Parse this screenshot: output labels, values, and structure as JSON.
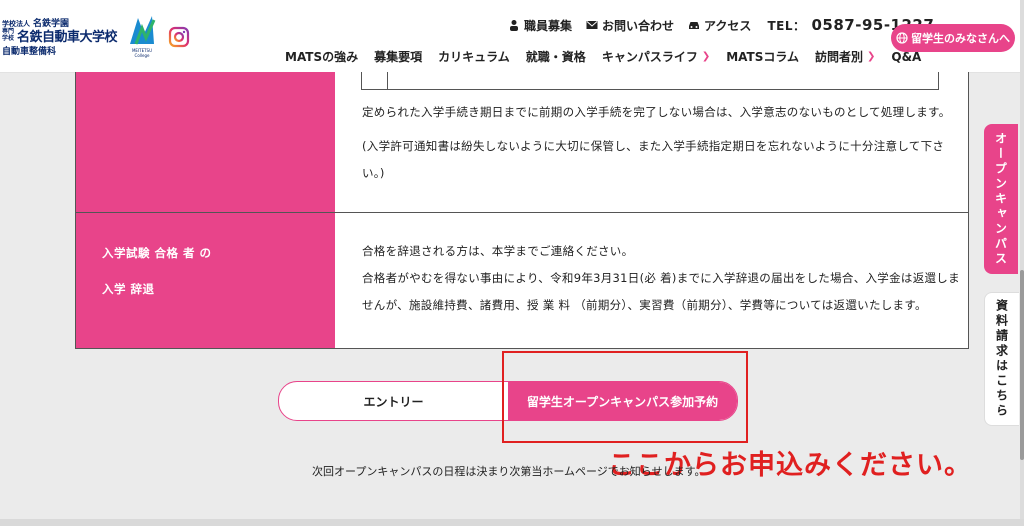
{
  "logo": {
    "corp": "学校法人",
    "group": "名鉄学園",
    "small": "専門学校",
    "main": "名鉄自動車大学校",
    "sub": "自動車整備科",
    "mark_label": "MEITETSU College"
  },
  "topbar": {
    "staff": "職員募集",
    "contact": "お問い合わせ",
    "access": "アクセス",
    "tel_label": "TEL：",
    "tel_number": "0587-95-1227"
  },
  "intl_button": "留学生のみなさんへ",
  "nav": [
    {
      "label": "MATSの強み"
    },
    {
      "label": "募集要項"
    },
    {
      "label": "カリキュラム"
    },
    {
      "label": "就職・資格"
    },
    {
      "label": "キャンパスライフ",
      "chevron": true
    },
    {
      "label": "MATSコラム"
    },
    {
      "label": "訪問者別",
      "chevron": true
    },
    {
      "label": "Q&A"
    }
  ],
  "row1": {
    "line1": "定められた入学手続き期日までに前期の入学手続を完了しない場合は、入学意志のないものとして処理します。",
    "line2": "(入学許可通知書は紛失しないように大切に保管し、また入学手続指定期日を忘れないように十分注意して下さ",
    "line3": "い。)"
  },
  "row2": {
    "label1": "入学試験 合格 者 の",
    "label2": "入学 辞退",
    "line1": "合格を辞退される方は、本学までご連絡ください。",
    "line2": "合格者がやむを得ない事由により、令和9年3月31日(必 着)までに入学辞退の届出をした場合、入学金は返還しま",
    "line3": "せんが、施設維持費、諸費用、授 業 料 （前期分）、実習費（前期分）、学費等については返還いたします。"
  },
  "buttons": {
    "entry": "エントリー",
    "open_campus": "留学生オープンキャンパス参加予約"
  },
  "annotation": "ここからお申込みください。",
  "note": "次回オープンキャンパスの日程は決まり次第当ホームページでお知らせします。",
  "side": {
    "open": "オープンキャンパス",
    "request": "資料請求はこちら"
  },
  "colors": {
    "accent": "#e8448a",
    "annotation_red": "#e02020",
    "brand_navy": "#0b2a6d"
  }
}
